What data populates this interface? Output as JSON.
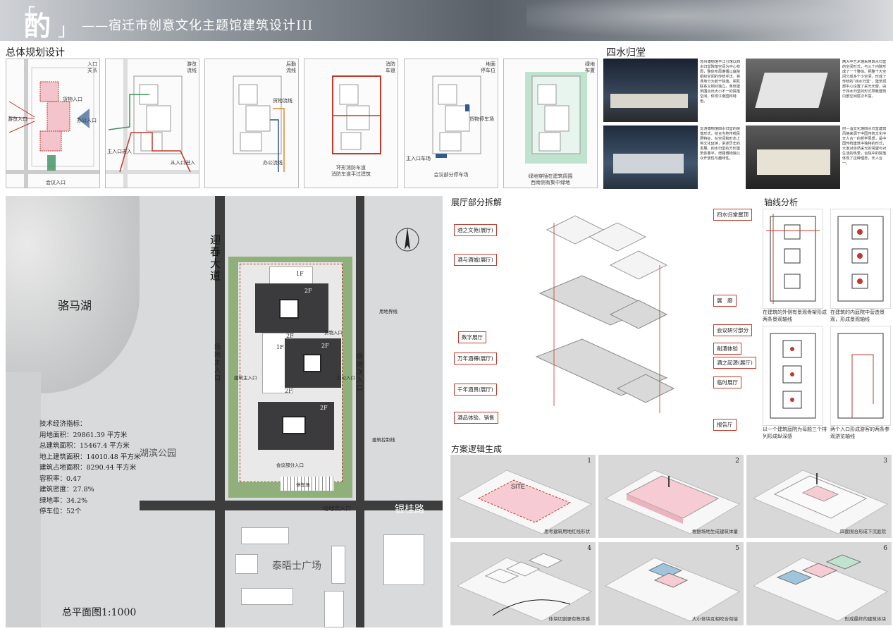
{
  "header": {
    "logo_char": "酌",
    "bracket_left": "「",
    "bracket_right": "」",
    "title": "——宿迁市创意文化主题馆建筑设计III"
  },
  "planning": {
    "title": "总体规划设计",
    "diagrams": [
      {
        "tag": "入口\n关系",
        "labels": [
          "货物入口",
          "游览入口",
          "办公入口",
          "会议入口"
        ],
        "caption": ""
      },
      {
        "tag": "游览\n流线",
        "labels": [
          "主入口进入",
          "从入口进入"
        ],
        "caption": ""
      },
      {
        "tag": "后勤\n流线",
        "labels": [
          "货物流线",
          "办公流线"
        ],
        "caption": ""
      },
      {
        "tag": "消防\n车道",
        "labels": [],
        "caption": "环形消防车道\n消防车道平过建筑"
      },
      {
        "tag": "地面\n停车位",
        "labels": [
          "主入口车场",
          "货物停车场"
        ],
        "caption": "会议部分停车场"
      },
      {
        "tag": "绿地\n布置",
        "labels": [],
        "caption": "绿地穿插在建筑周围\n西南侧有集中绿地"
      }
    ]
  },
  "siwater": {
    "title": "四水归堂",
    "texts": [
      "苏州博物馆平江分馆以四水归堂院落空间为中心布局，整体布局遵循以庭院组织空间的传统手法，将场地分为若干院落，相互联系又相对独立。单体建筑围合出大小不一的院落空间，体现江南园林特色。",
      "两大中艺术馆采用四水归堂的空间形式，与三个内院形成了一个整体。把整个大空间分成多个小空间，形成了传统的“四水归堂”，建筑顶部中心设置了采光天窗，由于四水归堂的形式导致建筑内部空间层次丰富。",
      "龙游博物馆四水归堂的院落形式，结合当地传统民居特征，在空间和形态上将文化延续，讲述历史的发展，四水归堂的方形建筑体量半，增强博物馆公众开放性与趣味性。",
      "附—酒文化馆四水归堂建筑风格来源于中国传统文化中天人合一的哲学思想，是中国传统建筑中独特的形式，大家对自然采光的渴望与对生活的热爱，合院中的院落体现了这种理念，天人合一。"
    ]
  },
  "site": {
    "lake_name": "骆马湖",
    "road1": "迎春大道",
    "road2": "银桂路",
    "park": "湖滨公园",
    "plaza": "泰晤士广场",
    "plan_title": "总平面图1:1000",
    "labels": {
      "main_entry": "场地主入口",
      "side_entry": "场地次入口",
      "side_entry2": "场地次入口",
      "bld_entry": "建筑主入口",
      "office_entry": "办公入口",
      "cargo_entry": "货物入口",
      "meeting_entry": "会议部分入口",
      "parking": "停车场",
      "red_line": "用地界线",
      "setback": "建筑控制线",
      "floor_1f_a": "1F",
      "floor_2f_a": "2F",
      "floor_1f_b": "1F",
      "floor_2f_b": "2F",
      "floor_2f_c": "2F",
      "floor_2f_d": "2F",
      "floor_2f_e": "2F"
    },
    "stats_title": "技术经济指标：",
    "stats": [
      "用地面积：29861.39 平方米",
      "总建筑面积：15467.4 平方米",
      "地上建筑面积：14010.48 平方米",
      "建筑占地面积：8290.44 平方米",
      "容积率：0.47",
      "建筑密度：27.8%",
      "绿地率：34.2%",
      "停车位：52个"
    ]
  },
  "explode": {
    "title": "展厅部分拆解",
    "left_labels": [
      "酒之文苑(展厅)",
      "酒与酒城(展厅)",
      "数字展厅",
      "万年酒樽(展厅)",
      "千年酒贯(展厅)",
      "酒品体验、销售"
    ],
    "right_labels": [
      "四水归堂屋顶",
      "展　廊",
      "会议研讨部分",
      "削酒体验",
      "酒之起源(展厅)",
      "临时展厅",
      "报告厅"
    ]
  },
  "axis": {
    "title": "轴线分析",
    "captions": [
      "在建筑的外侧有景观骨架形成两条景观轴线",
      "在建筑的内庭院中营造景观，形成景观轴线",
      "以一个建筑庭院为母题三个排列形成纵深感",
      "两个入口形成游客的两条参观游览轴线"
    ]
  },
  "logic": {
    "title": "方案逻辑生成",
    "steps": [
      {
        "num": "1",
        "caption": "思考建筑用地红线形状",
        "inner": "SITE"
      },
      {
        "num": "2",
        "caption": "根据场地生成建筑体量",
        "inner": ""
      },
      {
        "num": "3",
        "caption": "四面围合形成下沉庭院",
        "inner": ""
      },
      {
        "num": "4",
        "caption": "体块切割更有秩序感",
        "inner": ""
      },
      {
        "num": "5",
        "caption": "大小体块互相咬合衔接",
        "inner": ""
      },
      {
        "num": "6",
        "caption": "形成最终的建筑体块",
        "inner": ""
      }
    ]
  },
  "colors": {
    "accent_red": "#c0392b",
    "green": "#3c8f5c",
    "blue": "#2f5b8f",
    "orange": "#d98b2b",
    "building_pink": "#f1c7cf",
    "building_blue": "#9fc5dd",
    "building_green": "#bfe3cf"
  }
}
